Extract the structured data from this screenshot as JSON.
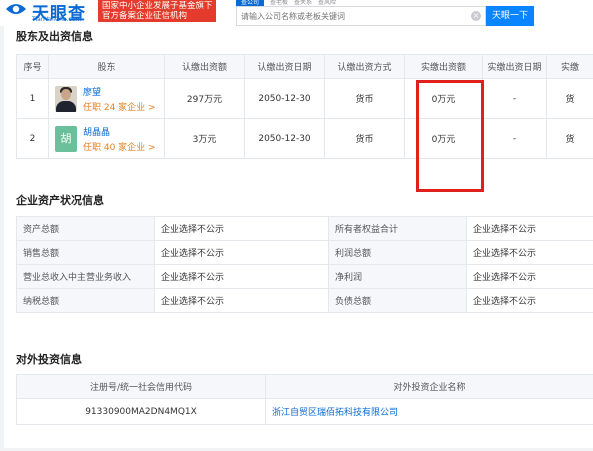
{
  "header": {
    "logo_text": "天眼查",
    "logo_sub": "TianYanCha.com",
    "banner_line1": "国家中小企业发展子基金旗下",
    "banner_line2": "官方备案企业征信机构",
    "search_tabs": [
      "查公司",
      "查老板",
      "查关系",
      "查风险"
    ],
    "search_placeholder": "请输入公司名称或老板关键词",
    "search_button": "天眼一下",
    "clear_icon": "×"
  },
  "shareholders": {
    "title": "股东及出资信息",
    "columns": [
      "序号",
      "股东",
      "认缴出资额",
      "认缴出资日期",
      "认缴出资方式",
      "实缴出资额",
      "实缴出资日期",
      "实缴"
    ],
    "rows": [
      {
        "index": "1",
        "name": "廖望",
        "role": "任职 24 家企业 >",
        "sub_amount": "297万元",
        "sub_date": "2050-12-30",
        "sub_method": "货币",
        "paid_amount": "0万元",
        "paid_date": "-",
        "paid_method": "货"
      },
      {
        "index": "2",
        "avatar_char": "胡",
        "name": "胡晶晶",
        "role": "任职 40 家企业 >",
        "sub_amount": "3万元",
        "sub_date": "2050-12-30",
        "sub_method": "货币",
        "paid_amount": "0万元",
        "paid_date": "-",
        "paid_method": "货"
      }
    ]
  },
  "assets": {
    "title": "企业资产状况信息",
    "rows": [
      [
        "资产总额",
        "企业选择不公示",
        "所有者权益合计",
        "企业选择不公示"
      ],
      [
        "销售总额",
        "企业选择不公示",
        "利润总额",
        "企业选择不公示"
      ],
      [
        "营业总收入中主营业务收入",
        "企业选择不公示",
        "净利润",
        "企业选择不公示"
      ],
      [
        "纳税总额",
        "企业选择不公示",
        "负债总额",
        "企业选择不公示"
      ]
    ]
  },
  "investments": {
    "title": "对外投资信息",
    "columns": [
      "注册号/统一社会信用代码",
      "对外投资企业名称"
    ],
    "rows": [
      {
        "code": "91330900MA2DN4MQ1X",
        "company": "浙江自贸区瑞佰拓科技有限公司"
      }
    ]
  },
  "colors": {
    "brand": "#0a6ad4",
    "highlight_box": "#e0201b",
    "banner": "#e43b2c",
    "orange_text": "#e87f1a"
  }
}
